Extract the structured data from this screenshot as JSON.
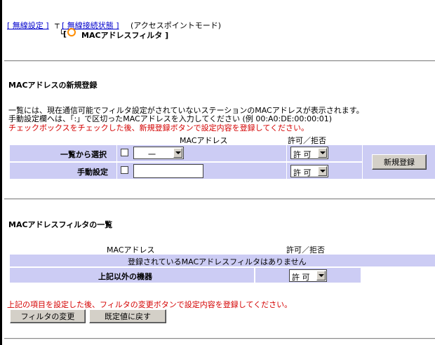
{
  "breadcrumb": {
    "parent_link": "[ 無線設定 ]",
    "child_link": "[ 無線接続状態 ]",
    "mode": "(アクセスポイントモード)",
    "current_prefix": "[",
    "current_label": "MACアドレスフィルタ ]",
    "tree_glyph_top": "┬",
    "tree_glyph_bottom": "└"
  },
  "new_entry": {
    "heading": "MACアドレスの新規登録",
    "desc_line1": "一覧には、現在通信可能でフィルタ設定がされていないステーションのMACアドレスが表示されます。",
    "desc_line2": "手動設定欄へは、「:」で区切ったMACアドレスを入力してください (例 00:A0:DE:00:00:01)",
    "warning": "チェックボックスをチェックした後、新規登録ボタンで設定内容を登録してください。",
    "col_mac": "MACアドレス",
    "col_permit": "許可／拒否",
    "row_list_label": "一覧から選択",
    "row_list_select": "一",
    "row_manual_label": "手動設定",
    "manual_input_value": "",
    "permit_value_1": "許 可",
    "permit_value_2": "許 可",
    "register_button": "新規登録"
  },
  "filter_list": {
    "heading": "MACアドレスフィルタの一覧",
    "col_mac": "MACアドレス",
    "col_permit": "許可／拒否",
    "empty_message": "登録されているMACアドレスフィルタはありません",
    "other_devices_label": "上記以外の機器",
    "other_devices_value": "許 可"
  },
  "footer": {
    "warning": "上記の項目を設定した後、フィルタの変更ボタンで設定内容を登録してください。",
    "change_button": "フィルタの変更",
    "reset_button": "既定値に戻す"
  },
  "colors": {
    "band": "#ccccf4",
    "warning": "#d40000",
    "link": "#0000cc"
  }
}
